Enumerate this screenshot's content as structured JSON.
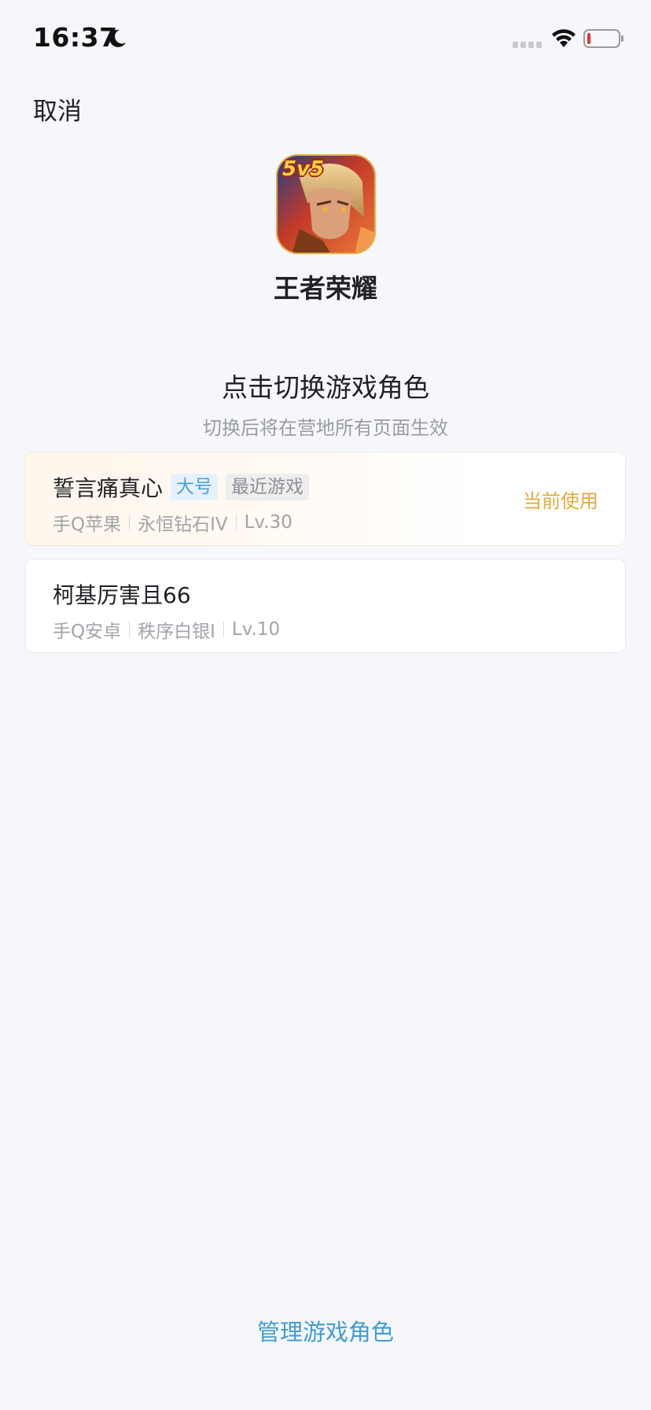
{
  "status_bar": {
    "time": "16:37",
    "icons": [
      "moon-icon",
      "signal-icon",
      "wifi-icon",
      "battery-icon"
    ]
  },
  "nav": {
    "cancel_label": "取消"
  },
  "game": {
    "name": "王者荣耀",
    "icon_badge": "5v5"
  },
  "section": {
    "title": "点击切换游戏角色",
    "subtitle": "切换后将在营地所有页面生效"
  },
  "roles": [
    {
      "name": "誓言痛真心",
      "tags": [
        "大号",
        "最近游戏"
      ],
      "platform": "手Q苹果",
      "rank": "永恒钻石IV",
      "level": "Lv.30",
      "status": "当前使用"
    },
    {
      "name": "柯基厉害且66",
      "platform": "手Q安卓",
      "rank": "秩序白银I",
      "level": "Lv.10"
    }
  ],
  "footer": {
    "manage_label": "管理游戏角色"
  },
  "colors": {
    "background": "#f6f7fb",
    "accent_blue": "#3f9cd8",
    "current_gold": "#e5a93a",
    "battery_low": "#e0352b"
  }
}
